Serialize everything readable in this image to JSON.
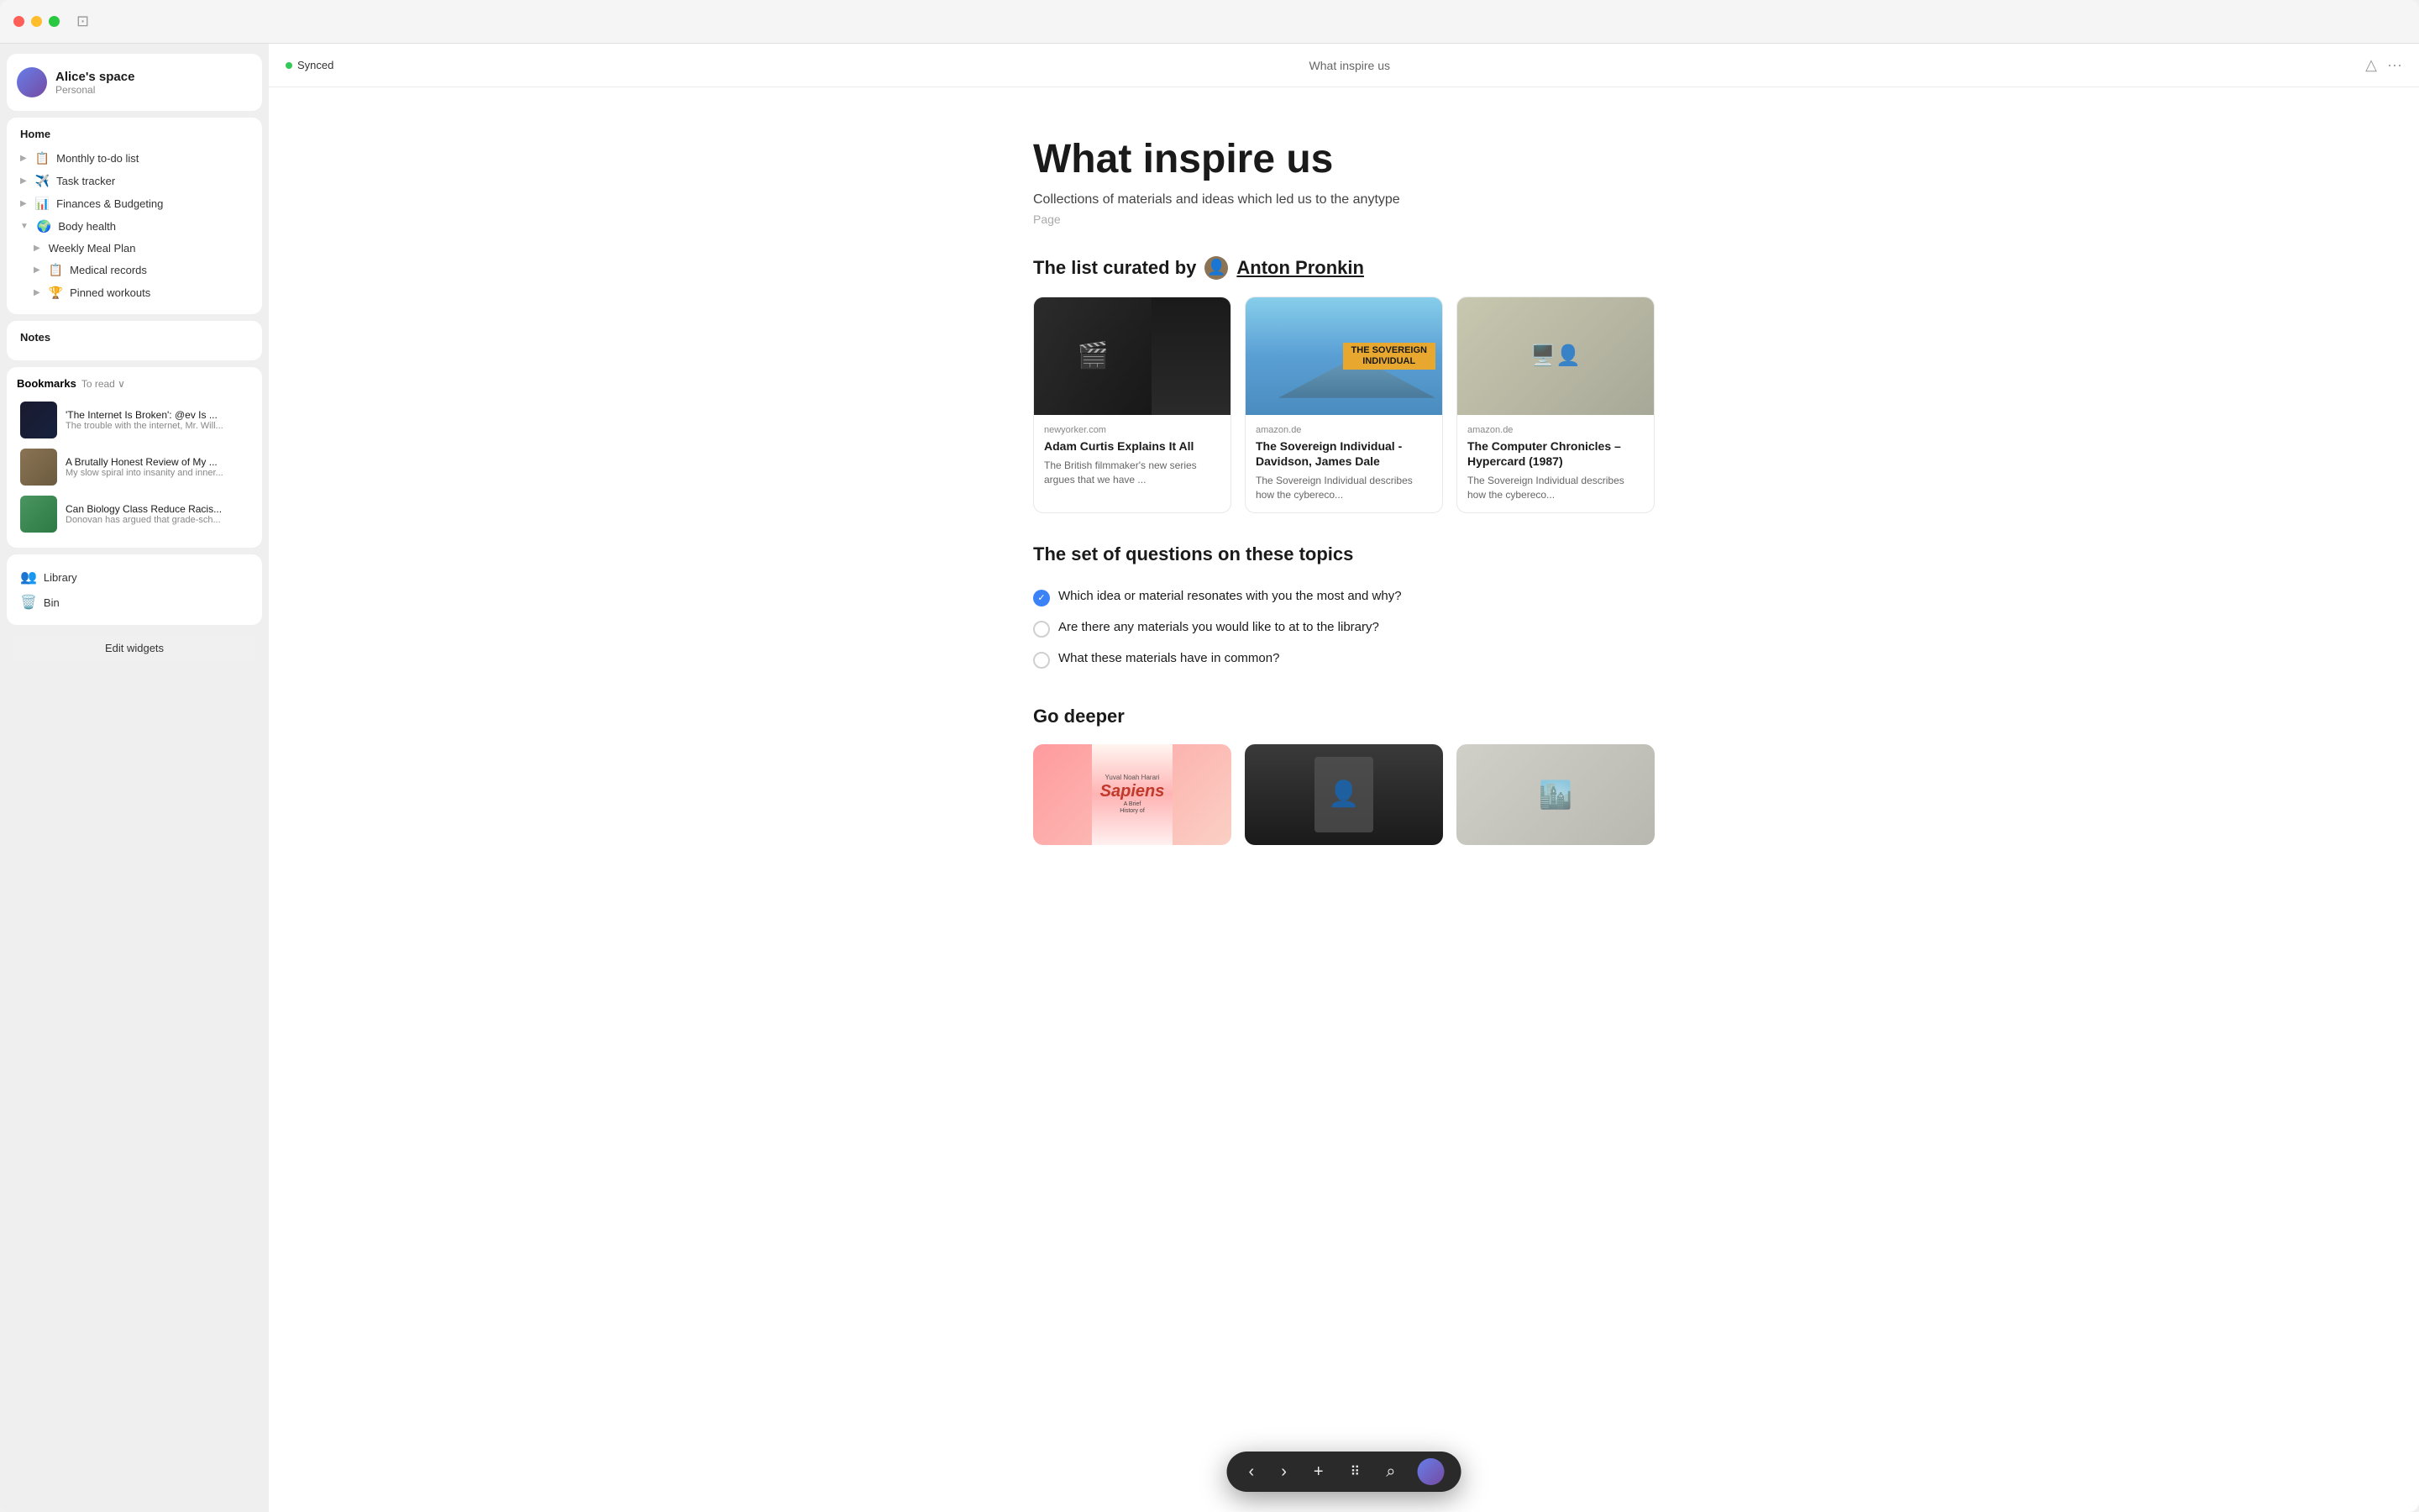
{
  "window": {
    "title": "What inspire us"
  },
  "topbar": {
    "synced_label": "Synced",
    "page_title": "What inspire us"
  },
  "sidebar": {
    "workspace": {
      "name": "Alice's space",
      "subtitle": "Personal"
    },
    "home_label": "Home",
    "nav_items": [
      {
        "id": "monthly-todo",
        "icon": "📋",
        "label": "Monthly to-do list",
        "indent": 0,
        "has_arrow": true
      },
      {
        "id": "task-tracker",
        "icon": "✈️",
        "label": "Task tracker",
        "indent": 0,
        "has_arrow": true
      },
      {
        "id": "finances",
        "icon": "📊",
        "label": "Finances & Budgeting",
        "indent": 0,
        "has_arrow": true
      },
      {
        "id": "body-health",
        "icon": "🌍",
        "label": "Body health",
        "indent": 0,
        "has_arrow": true,
        "expanded": true
      },
      {
        "id": "weekly-meal",
        "icon": "",
        "label": "Weekly Meal Plan",
        "indent": 1,
        "has_arrow": true
      },
      {
        "id": "medical",
        "icon": "📋",
        "label": "Medical records",
        "indent": 1,
        "has_arrow": true
      },
      {
        "id": "pinned",
        "icon": "🏆",
        "label": "Pinned workouts",
        "indent": 1,
        "has_arrow": true
      }
    ],
    "notes_label": "Notes",
    "bookmarks": {
      "title": "Bookmarks",
      "sub": "To read ∨",
      "items": [
        {
          "id": "internet-broken",
          "title": "'The Internet Is Broken': @ev Is ...",
          "desc": "The trouble with the internet, Mr. Will...",
          "thumb_color": "#1a1a2e"
        },
        {
          "id": "brutally-honest",
          "title": "A Brutally Honest Review of My ...",
          "desc": "My slow spiral into insanity and inner...",
          "thumb_color": "#8B7355"
        },
        {
          "id": "biology-racism",
          "title": "Can Biology Class Reduce Racis...",
          "desc": "Donovan has argued that grade-sch...",
          "thumb_color": "#4a9560"
        }
      ]
    },
    "library_label": "Library",
    "bin_label": "Bin",
    "edit_widgets": "Edit widgets"
  },
  "page": {
    "title": "What inspire us",
    "subtitle": "Collections of materials and ideas which led us to the anytype",
    "type": "Page",
    "curated_by": "The list curated by",
    "author": "Anton Pronkin",
    "cards": [
      {
        "source": "newyorker.com",
        "title": "Adam Curtis Explains It All",
        "desc": "The British filmmaker's new series argues that we have ..."
      },
      {
        "source": "amazon.de",
        "title": "The Sovereign Individual - Davidson, James Dale",
        "desc": "The Sovereign Individual describes how the cybereco..."
      },
      {
        "source": "amazon.de",
        "title": "The Computer Chronicles – Hypercard (1987)",
        "desc": "The Sovereign Individual describes how the cybereco..."
      }
    ],
    "questions_heading": "The set of questions on these topics",
    "questions": [
      {
        "checked": true,
        "text": "Which idea or material resonates with you the most and why?"
      },
      {
        "checked": false,
        "text": "Are there any materials you would like to at to the library?"
      },
      {
        "checked": false,
        "text": "What these materials have in common?"
      }
    ],
    "go_deeper_heading": "Go deeper",
    "deeper_items": [
      {
        "id": "sapiens",
        "label": "Sapiens"
      },
      {
        "id": "person",
        "label": ""
      },
      {
        "id": "city",
        "label": ""
      }
    ]
  },
  "toolbar": {
    "back": "‹",
    "forward": "›",
    "add": "+",
    "grid": "⠿",
    "search": "⌕"
  }
}
